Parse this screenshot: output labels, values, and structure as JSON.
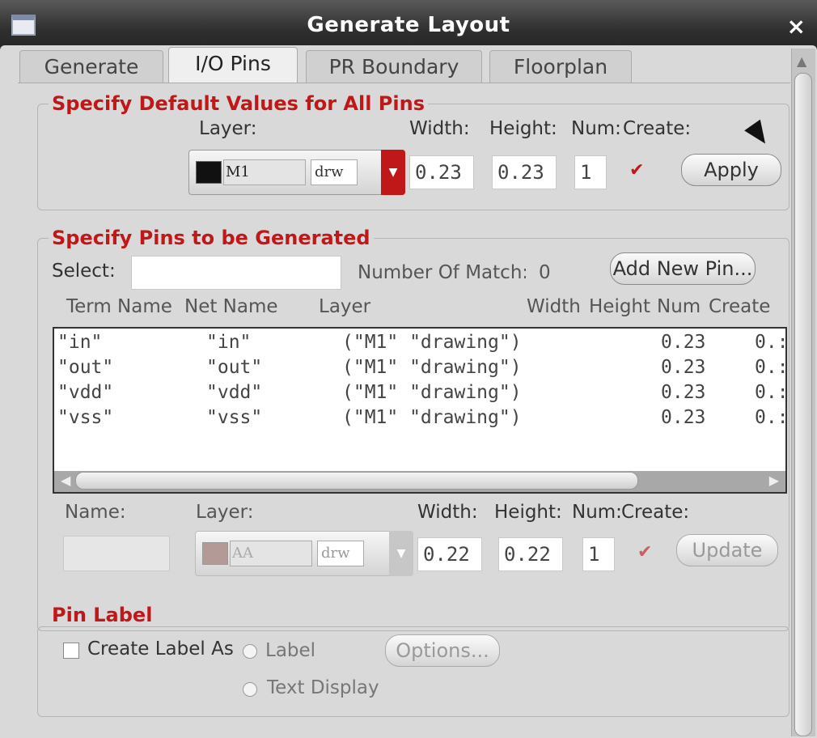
{
  "window": {
    "title": "Generate Layout",
    "close": "×"
  },
  "tabs": [
    {
      "label": "Generate"
    },
    {
      "label": "I/O Pins",
      "active": true
    },
    {
      "label": "PR Boundary"
    },
    {
      "label": "Floorplan"
    }
  ],
  "defaults": {
    "title": "Specify Default Values for All Pins",
    "layer_label": "Layer:",
    "width_label": "Width:",
    "height_label": "Height:",
    "num_label": "Num:",
    "create_label": "Create:",
    "layer_name": "M1",
    "layer_purpose": "drw",
    "layer_color": "#111111",
    "width": "0.23",
    "height": "0.23",
    "num": "1",
    "create_checked": true,
    "apply_label": "Apply"
  },
  "pins": {
    "title": "Specify Pins to be Generated",
    "select_label": "Select:",
    "select_value": "",
    "match_label": "Number Of Match:",
    "match_count": "0",
    "add_label": "Add New Pin...",
    "columns": [
      "Term Name",
      "Net Name",
      "Layer",
      "Width",
      "Height",
      "Num",
      "Create"
    ],
    "rows": [
      {
        "term": "\"in\"",
        "net": "\"in\"",
        "layer": "(\"M1\" \"drawing\")",
        "width": "0.23",
        "height": "0.:"
      },
      {
        "term": "\"out\"",
        "net": "\"out\"",
        "layer": "(\"M1\" \"drawing\")",
        "width": "0.23",
        "height": "0.:"
      },
      {
        "term": "\"vdd\"",
        "net": "\"vdd\"",
        "layer": "(\"M1\" \"drawing\")",
        "width": "0.23",
        "height": "0.:"
      },
      {
        "term": "\"vss\"",
        "net": "\"vss\"",
        "layer": "(\"M1\" \"drawing\")",
        "width": "0.23",
        "height": "0.:"
      }
    ],
    "edit": {
      "name_label": "Name:",
      "layer_label": "Layer:",
      "width_label": "Width:",
      "height_label": "Height:",
      "num_label": "Num:",
      "create_label": "Create:",
      "name_value": "",
      "layer_name": "AA",
      "layer_purpose": "drw",
      "layer_color": "#b49a96",
      "width": "0.22",
      "height": "0.22",
      "num": "1",
      "update_label": "Update"
    }
  },
  "pin_label": {
    "title": "Pin Label",
    "create_label_as": "Create Label As",
    "option_label": "Label",
    "option_text_display": "Text Display",
    "options_button": "Options..."
  }
}
